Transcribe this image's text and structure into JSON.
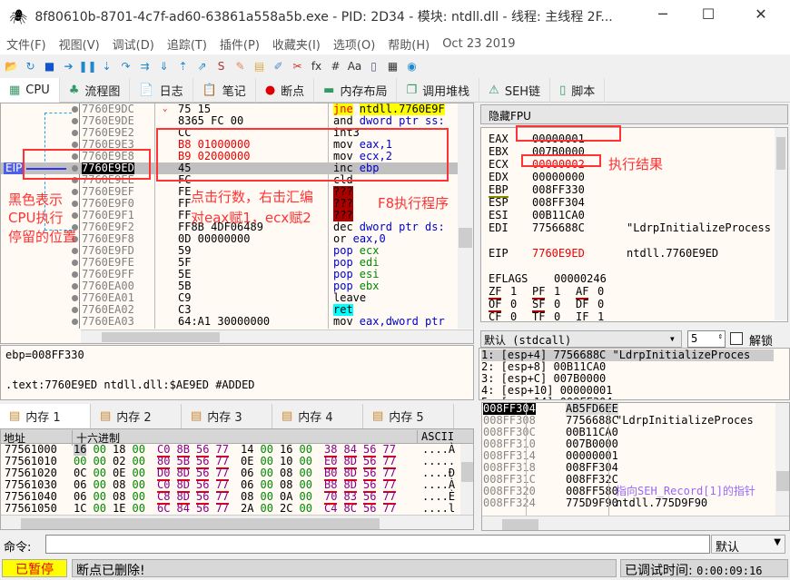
{
  "window": {
    "title": "8f80610b-8701-4c7f-ad60-63861a558a5b.exe - PID: 2D34 - 模块: ntdll.dll - 线程: 主线程 2F...",
    "minimize": "─",
    "maximize": "☐",
    "close": "✕"
  },
  "menu": [
    "文件(F)",
    "视图(V)",
    "调试(D)",
    "追踪(T)",
    "插件(P)",
    "收藏夹(I)",
    "选项(O)",
    "帮助(H)",
    "Oct 23 2019"
  ],
  "toolbar": [
    "open-icon",
    "restart-icon",
    "stop-icon",
    "run-icon",
    "pause-icon",
    "step-into-icon",
    "step-over-icon",
    "trace-into-icon",
    "trace-over-icon",
    "execute-till-return-icon",
    "run-to-user-code-icon",
    "scylla-icon",
    "patch-icon",
    "comment-icon",
    "label-icon",
    "bookmark-icon",
    "function-icon",
    "hash-icon",
    "strings-icon",
    "calculator-device-icon",
    "calculator-icon",
    "globe-icon"
  ],
  "toolbar_glyphs": [
    "📂",
    "↻",
    "■",
    "➔",
    "❚❚",
    "⇣",
    "↷",
    "⇉",
    "⇓",
    "⇡",
    "⇗",
    "S",
    "✎",
    "▤",
    "✐",
    "✂",
    "fx",
    "#",
    "Aa",
    "▯",
    "▦",
    "◉"
  ],
  "tabs": [
    {
      "label": "CPU",
      "icon": "▦"
    },
    {
      "label": "流程图",
      "icon": "♣"
    },
    {
      "label": "日志",
      "icon": "📄"
    },
    {
      "label": "笔记",
      "icon": "📋"
    },
    {
      "label": "断点",
      "icon": "●"
    },
    {
      "label": "内存布局",
      "icon": "▬"
    },
    {
      "label": "调用堆栈",
      "icon": "❐"
    },
    {
      "label": "SEH链",
      "icon": "⚠"
    },
    {
      "label": "脚本",
      "icon": "▯"
    }
  ],
  "disasm": {
    "eip_label": "EIP",
    "rows": [
      {
        "addr": "7760E9DC",
        "bytes": "75 15",
        "mn": "jne",
        "ops": "ntdll.7760E9F",
        "kind": "jump",
        "marker": "⌄"
      },
      {
        "addr": "7760E9DE",
        "bytes": "8365 FC 00",
        "mn": "and",
        "ops": "dword ptr ss:",
        "kind": "normal"
      },
      {
        "addr": "7760E9E2",
        "bytes": "CC",
        "mn": "int3",
        "ops": "",
        "kind": "normal"
      },
      {
        "addr": "7760E9E3",
        "bytes": "B8 01000000",
        "mn": "mov",
        "ops": "eax,1",
        "kind": "patched"
      },
      {
        "addr": "7760E9E8",
        "bytes": "B9 02000000",
        "mn": "mov",
        "ops": "ecx,2",
        "kind": "patched"
      },
      {
        "addr": "7760E9ED",
        "bytes": "45",
        "mn": "inc",
        "ops": "ebp",
        "kind": "eip"
      },
      {
        "addr": "7760E9EE",
        "bytes": "FC",
        "mn": "cld",
        "ops": "",
        "kind": "normal"
      },
      {
        "addr": "7760E9EF",
        "bytes": "FE",
        "mn": "???",
        "ops": "",
        "kind": "invalid"
      },
      {
        "addr": "7760E9F0",
        "bytes": "FF",
        "mn": "???",
        "ops": "",
        "kind": "invalid"
      },
      {
        "addr": "7760E9F1",
        "bytes": "FF",
        "mn": "???",
        "ops": "",
        "kind": "invalid"
      },
      {
        "addr": "7760E9F2",
        "bytes": "FF8B 4DF06489",
        "mn": "dec",
        "ops": "dword ptr ds:",
        "kind": "normal"
      },
      {
        "addr": "7760E9F8",
        "bytes": "0D 00000000",
        "mn": "or",
        "ops": "eax,0",
        "kind": "normal"
      },
      {
        "addr": "7760E9FD",
        "bytes": "59",
        "mn": "pop",
        "ops": "ecx",
        "kind": "stack"
      },
      {
        "addr": "7760E9FE",
        "bytes": "5F",
        "mn": "pop",
        "ops": "edi",
        "kind": "stack"
      },
      {
        "addr": "7760E9FF",
        "bytes": "5E",
        "mn": "pop",
        "ops": "esi",
        "kind": "stack"
      },
      {
        "addr": "7760EA00",
        "bytes": "5B",
        "mn": "pop",
        "ops": "ebx",
        "kind": "stack"
      },
      {
        "addr": "7760EA01",
        "bytes": "C9",
        "mn": "leave",
        "ops": "",
        "kind": "normal"
      },
      {
        "addr": "7760EA02",
        "bytes": "C3",
        "mn": "ret",
        "ops": "",
        "kind": "ret"
      },
      {
        "addr": "7760EA03",
        "bytes": "64:A1 30000000",
        "mn": "mov",
        "ops": "eax,dword ptr",
        "kind": "normal"
      }
    ]
  },
  "annotations": {
    "black_means": "黑色表示\nCPU执行\n停留的位置",
    "click_line": "点击行数，右击汇编",
    "assign": "对eax赋1，ecx赋2",
    "f8": "F8执行程序",
    "result": "执行结果"
  },
  "info": {
    "line1": "ebp=008FF330",
    "line2": ".text:7760E9ED ntdll.dll:$AE9ED #ADDED"
  },
  "registers": {
    "header": "隐藏FPU",
    "regs": [
      {
        "name": "EAX",
        "value": "00000001",
        "comment": ""
      },
      {
        "name": "EBX",
        "value": "007B0000",
        "comment": ""
      },
      {
        "name": "ECX",
        "value": "00000002",
        "comment": "",
        "changed": true
      },
      {
        "name": "EDX",
        "value": "00000000",
        "comment": ""
      },
      {
        "name": "EBP",
        "value": "008FF330",
        "comment": ""
      },
      {
        "name": "ESP",
        "value": "008FF304",
        "comment": ""
      },
      {
        "name": "ESI",
        "value": "00B11CA0",
        "comment": ""
      },
      {
        "name": "EDI",
        "value": "7756688C",
        "comment": "\"LdrpInitializeProcess"
      }
    ],
    "eip": {
      "name": "EIP",
      "value": "7760E9ED",
      "comment": "ntdll.7760E9ED"
    },
    "eflags": {
      "name": "EFLAGS",
      "value": "00000246"
    },
    "flags": [
      [
        "ZF",
        "1"
      ],
      [
        "PF",
        "1"
      ],
      [
        "AF",
        "0"
      ],
      [
        "OF",
        "0"
      ],
      [
        "SF",
        "0"
      ],
      [
        "DF",
        "0"
      ],
      [
        "CF",
        "0"
      ],
      [
        "TF",
        "0"
      ],
      [
        "IF",
        "1"
      ]
    ]
  },
  "callconv": {
    "selected": "默认 (stdcall)",
    "count": "5",
    "unlock": "解锁",
    "args": [
      "1: [esp+4] 7756688C \"LdrpInitializeProces",
      "2: [esp+8] 00B11CA0",
      "3: [esp+C] 007B0000",
      "4: [esp+10] 00000001",
      "5: [esp+14] 008FF304"
    ]
  },
  "memory": {
    "tabs": [
      "内存 1",
      "内存 2",
      "内存 3",
      "内存 4",
      "内存 5"
    ],
    "col_addr": "地址",
    "col_hex": "十六进制",
    "col_ascii": "ASCII",
    "rows": [
      {
        "addr": "77561000",
        "hex": [
          "16",
          "00",
          "18",
          "00",
          "C0",
          "8B",
          "56",
          "77",
          "14",
          "00",
          "16",
          "00",
          "38",
          "84",
          "56",
          "77"
        ],
        "ascii": "....À"
      },
      {
        "addr": "77561010",
        "hex": [
          "00",
          "00",
          "02",
          "00",
          "80",
          "5B",
          "56",
          "77",
          "0E",
          "00",
          "10",
          "00",
          "E0",
          "8D",
          "56",
          "77"
        ],
        "ascii": "....."
      },
      {
        "addr": "77561020",
        "hex": [
          "0C",
          "00",
          "0E",
          "00",
          "D0",
          "8D",
          "56",
          "77",
          "06",
          "00",
          "08",
          "00",
          "B0",
          "8D",
          "56",
          "77"
        ],
        "ascii": "....Đ"
      },
      {
        "addr": "77561030",
        "hex": [
          "06",
          "00",
          "08",
          "00",
          "C0",
          "8D",
          "56",
          "77",
          "06",
          "00",
          "08",
          "00",
          "B8",
          "8D",
          "56",
          "77"
        ],
        "ascii": "....À"
      },
      {
        "addr": "77561040",
        "hex": [
          "06",
          "00",
          "08",
          "00",
          "C8",
          "8D",
          "56",
          "77",
          "08",
          "00",
          "0A",
          "00",
          "70",
          "83",
          "56",
          "77"
        ],
        "ascii": "....È"
      },
      {
        "addr": "77561050",
        "hex": [
          "1C",
          "00",
          "1E",
          "00",
          "6C",
          "84",
          "56",
          "77",
          "2A",
          "00",
          "2C",
          "00",
          "C4",
          "8C",
          "56",
          "77"
        ],
        "ascii": "....l"
      }
    ]
  },
  "stack": {
    "rows": [
      {
        "addr": "008FF304",
        "value": "AB5FD6EE",
        "comment": ""
      },
      {
        "addr": "008FF308",
        "value": "7756688C",
        "comment": "\"LdrpInitializeProces"
      },
      {
        "addr": "008FF30C",
        "value": "00B11CA0",
        "comment": ""
      },
      {
        "addr": "008FF310",
        "value": "007B0000",
        "comment": ""
      },
      {
        "addr": "008FF314",
        "value": "00000001",
        "comment": ""
      },
      {
        "addr": "008FF318",
        "value": "008FF304",
        "comment": ""
      },
      {
        "addr": "008FF31C",
        "value": "008FF32C",
        "comment": ""
      },
      {
        "addr": "008FF320",
        "value": "008FF580",
        "comment": "指向SEH_Record[1]的指针"
      },
      {
        "addr": "008FF324",
        "value": "775D9F90",
        "comment": "ntdll.775D9F90"
      }
    ]
  },
  "command": {
    "label": "命令:",
    "value": "",
    "mode": "默认"
  },
  "status": {
    "state": "已暂停",
    "message": "断点已删除!",
    "time_label": "已调试时间:",
    "time": "0:00:09:16"
  }
}
